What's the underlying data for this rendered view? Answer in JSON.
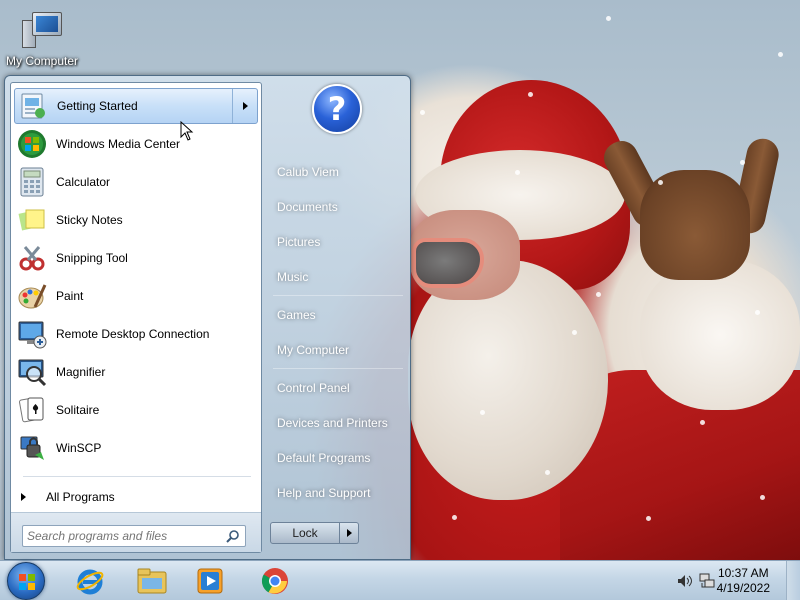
{
  "desktop": {
    "icon_label": "My Computer"
  },
  "start_menu": {
    "programs": [
      {
        "label": "Getting Started",
        "icon": "getting-started-icon",
        "highlighted": true,
        "has_submenu": true
      },
      {
        "label": "Windows Media Center",
        "icon": "windows-media-center-icon"
      },
      {
        "label": "Calculator",
        "icon": "calculator-icon"
      },
      {
        "label": "Sticky Notes",
        "icon": "sticky-notes-icon"
      },
      {
        "label": "Snipping Tool",
        "icon": "snipping-tool-icon"
      },
      {
        "label": "Paint",
        "icon": "paint-icon"
      },
      {
        "label": "Remote Desktop Connection",
        "icon": "remote-desktop-icon"
      },
      {
        "label": "Magnifier",
        "icon": "magnifier-icon"
      },
      {
        "label": "Solitaire",
        "icon": "solitaire-icon"
      },
      {
        "label": "WinSCP",
        "icon": "winscp-icon"
      }
    ],
    "all_programs_label": "All Programs",
    "search_placeholder": "Search programs and files",
    "right_links": [
      {
        "label": "Calub Viem"
      },
      {
        "label": "Documents"
      },
      {
        "label": "Pictures"
      },
      {
        "label": "Music"
      },
      {
        "label": "Games"
      },
      {
        "label": "My Computer"
      },
      {
        "label": "Control Panel"
      },
      {
        "label": "Devices and Printers"
      },
      {
        "label": "Default Programs"
      },
      {
        "label": "Help and Support"
      }
    ],
    "lock_label": "Lock",
    "help_glyph": "?"
  },
  "taskbar": {
    "pinned": [
      "internet-explorer-icon",
      "windows-explorer-icon",
      "media-player-icon",
      "chrome-icon"
    ],
    "clock_time": "10:37 AM",
    "clock_date": "4/19/2022"
  },
  "colors": {
    "highlight": "#c8e0f8",
    "right_pane_text": "#ffffff",
    "taskbar": "#c4d6e6"
  }
}
